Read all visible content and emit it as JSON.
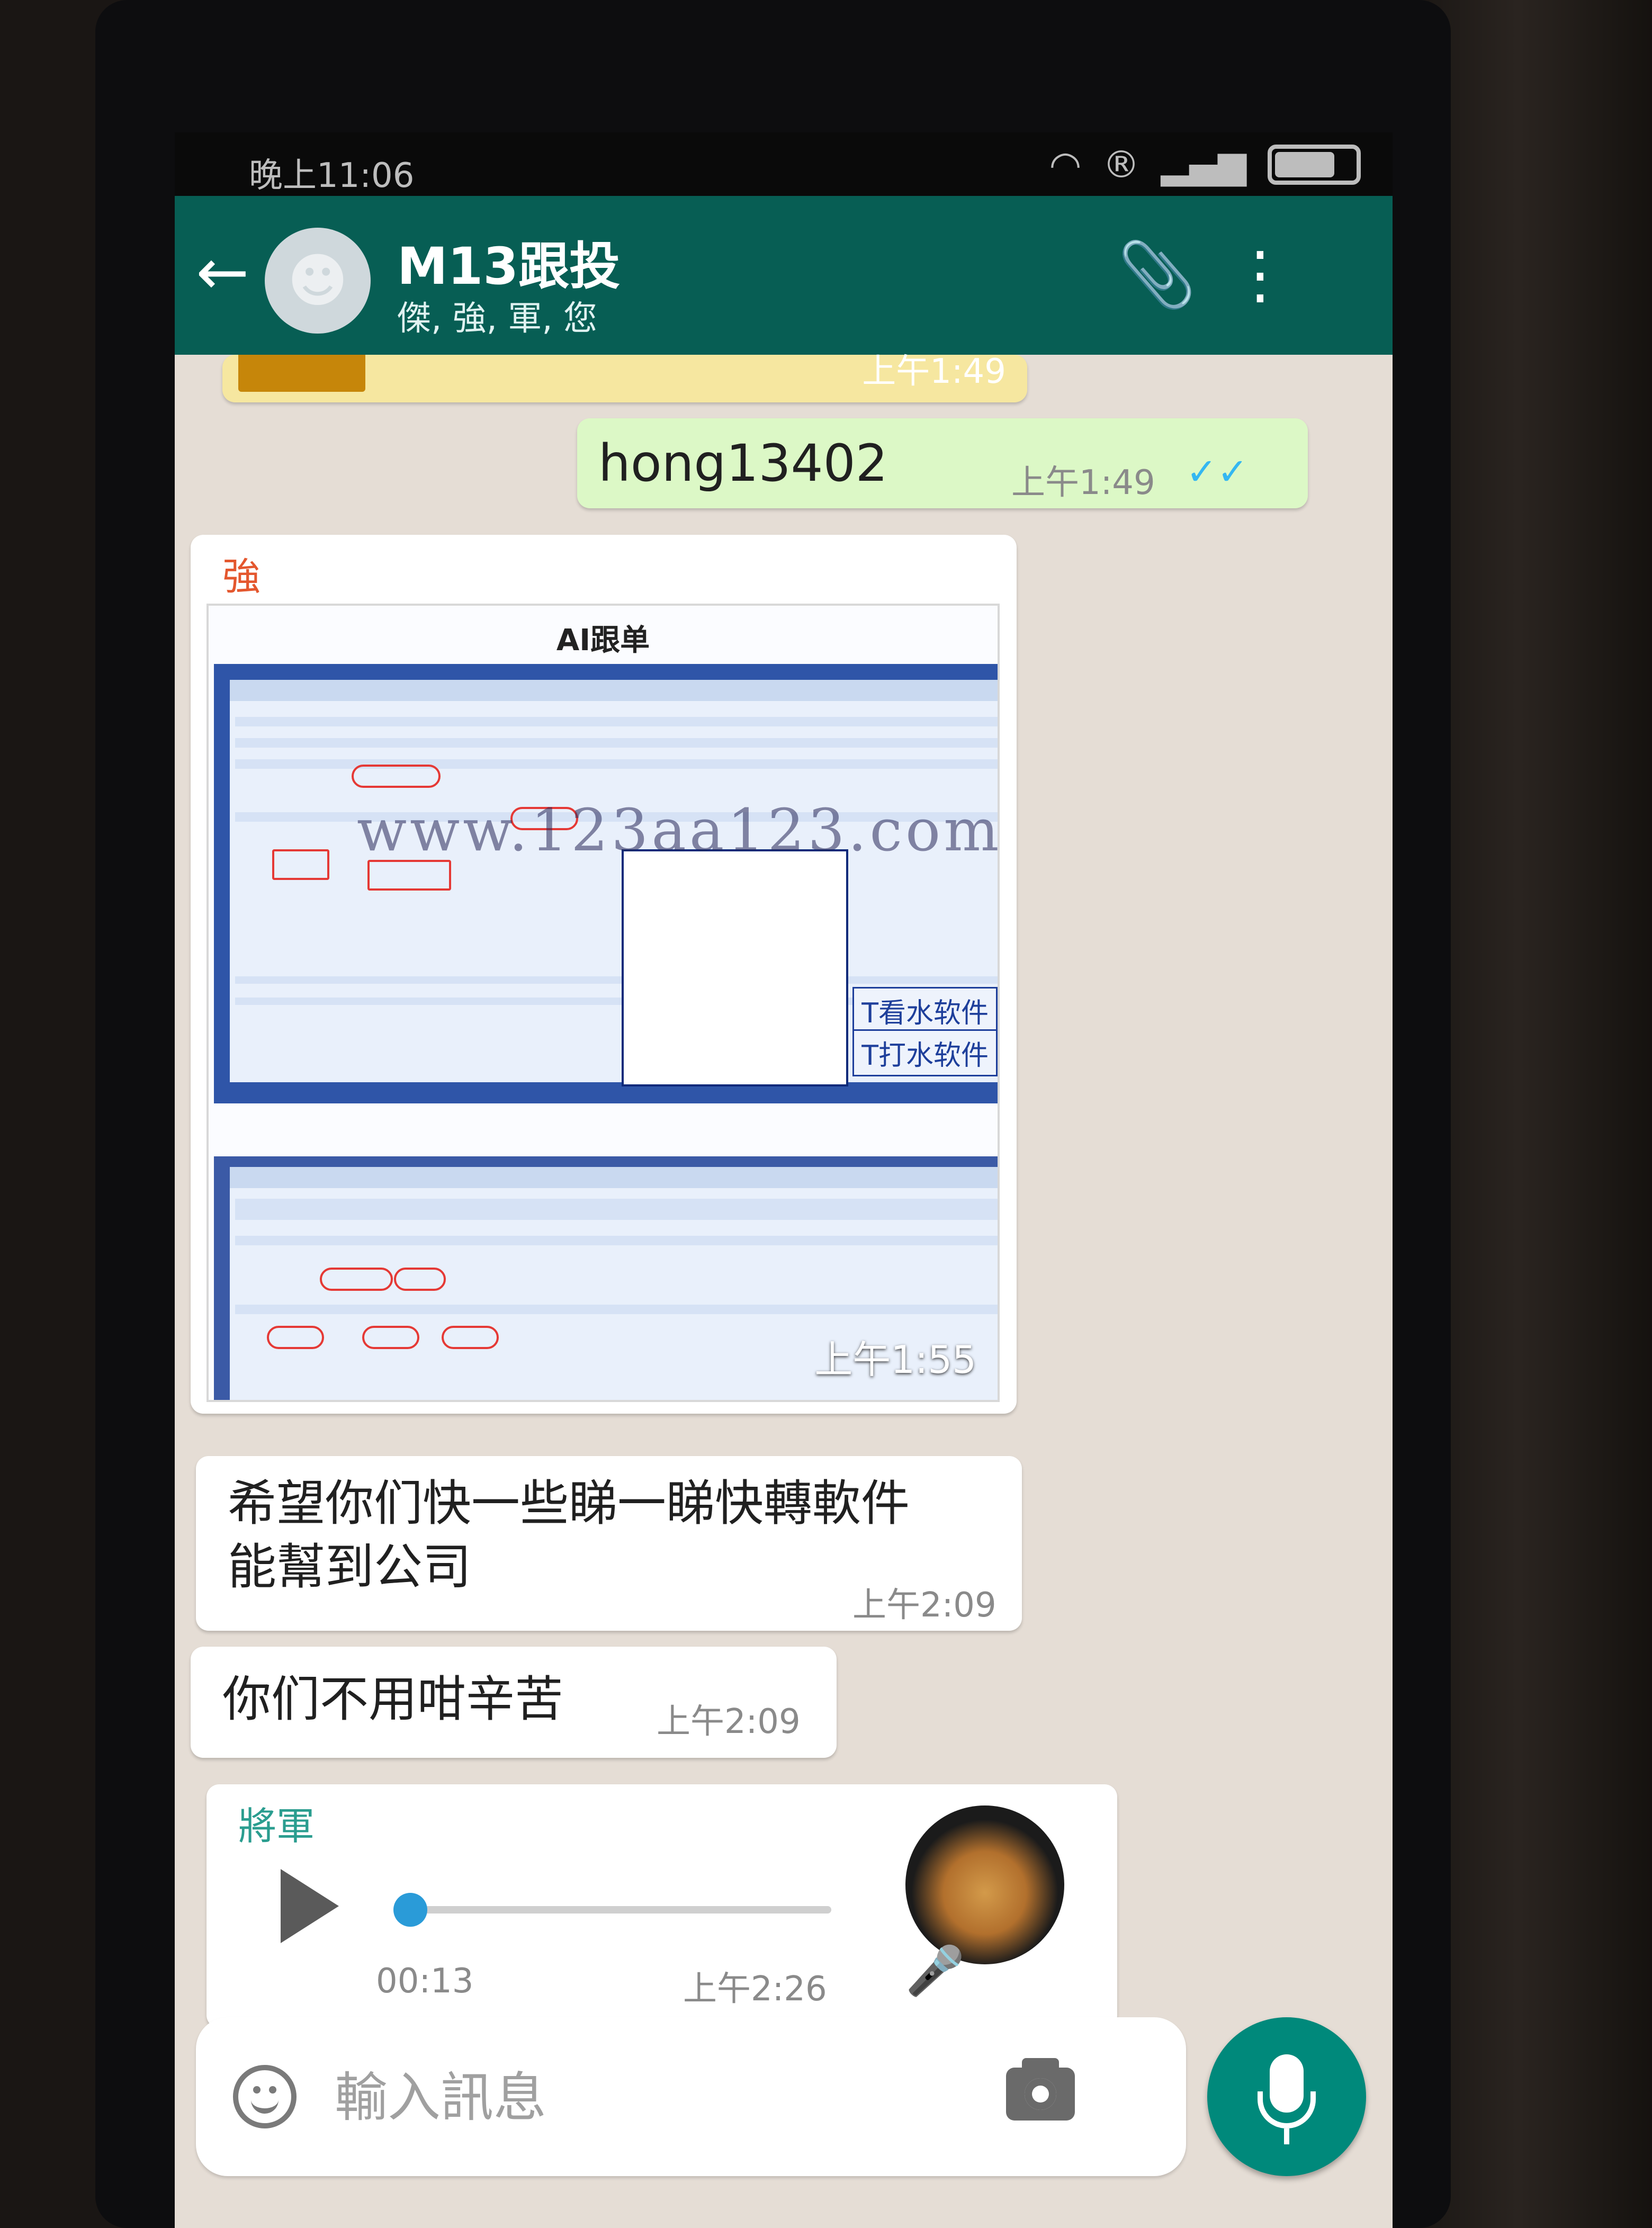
{
  "status_bar": {
    "time": "晚上11:06"
  },
  "toolbar": {
    "title": "M13跟投",
    "subtitle": "傑, 強, 軍, 您"
  },
  "messages": {
    "top_strip_time": "上午1:49",
    "outgoing": {
      "text": "hong13402",
      "time": "上午1:49"
    },
    "image_msg": {
      "sender": "強",
      "sender_color": "#e4572e",
      "image_title": "AI跟单",
      "watermark": "www.123aa123.com",
      "tag1": "T看水软件",
      "tag2": "T打水软件",
      "time": "上午1:55"
    },
    "text1": {
      "line1": "希望你们快一些睇一睇快轉軟件",
      "line2": "能幫到公司",
      "time": "上午2:09"
    },
    "text2": {
      "text": "你们不用咁辛苦",
      "time": "上午2:09"
    },
    "voice": {
      "sender": "將軍",
      "sender_color": "#2a9d8f",
      "duration": "00:13",
      "time": "上午2:26",
      "progress": 0.03
    }
  },
  "input": {
    "placeholder": "輸入訊息"
  },
  "colors": {
    "header": "#075e54",
    "outgoing_bubble": "#dcf8c6",
    "fab": "#00897b"
  }
}
